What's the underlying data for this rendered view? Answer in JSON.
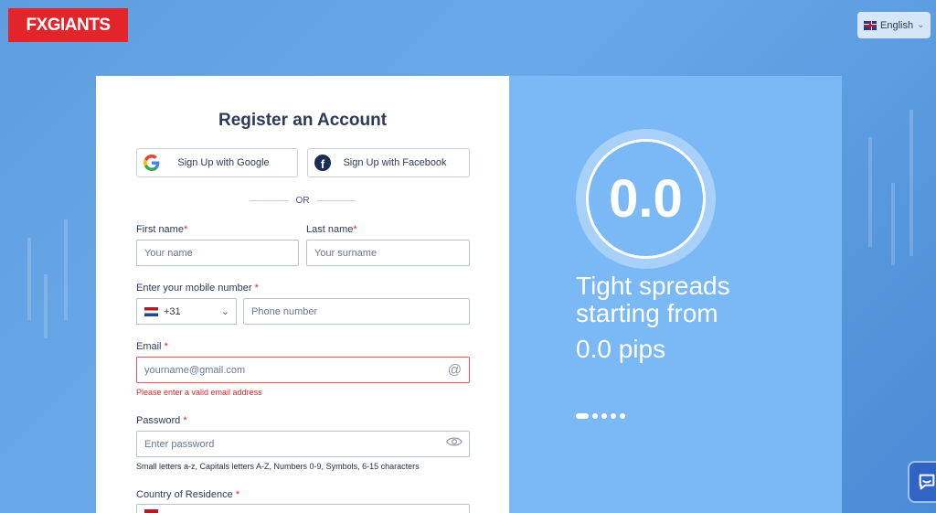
{
  "brand": {
    "logo_text": "FXGIANTS",
    "accent": "#e4242b"
  },
  "language": {
    "label": "English",
    "flag": "uk-flag-icon"
  },
  "form": {
    "title": "Register an Account",
    "google_label": "Sign Up with Google",
    "facebook_label": "Sign Up with Facebook",
    "or_label": "OR",
    "first_name": {
      "label": "First name",
      "required": "*",
      "placeholder": "Your name"
    },
    "last_name": {
      "label": "Last name",
      "required": "*",
      "placeholder": "Your surname"
    },
    "mobile": {
      "label": "Enter your mobile number",
      "required": "*",
      "country_code": "+31",
      "placeholder": "Phone number"
    },
    "email": {
      "label": "Email",
      "required": "*",
      "placeholder": "yourname@gmail.com",
      "error": "Please enter a valid email address"
    },
    "password": {
      "label": "Password",
      "required": "*",
      "placeholder": "Enter password",
      "hint": "Small letters a-z, Capitals letters A-Z, Numbers 0-9, Symbols, 6-15 characters"
    },
    "country": {
      "label": "Country of Residence",
      "required": "*"
    }
  },
  "promo": {
    "big_value": "0.0",
    "headline": "Tight spreads starting from",
    "pips": "0.0 pips",
    "slides": 5,
    "active_slide": 1
  },
  "colors": {
    "promo_bg": "#7ab9f6",
    "error": "#d42a2a",
    "text": "#2d3b58"
  }
}
